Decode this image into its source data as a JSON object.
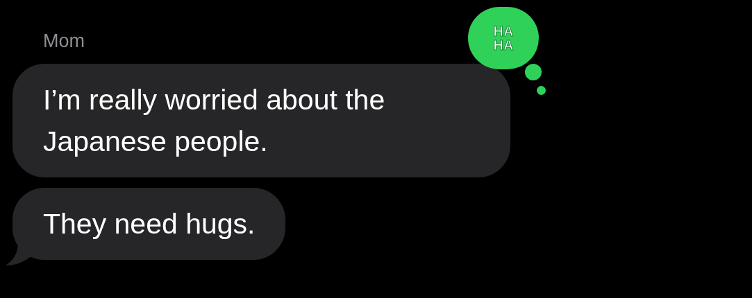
{
  "sender": "Mom",
  "messages": [
    {
      "text": "I’m really worried about the Japanese people.",
      "tail": false
    },
    {
      "text": "They need hugs.",
      "tail": true
    }
  ],
  "reaction": {
    "lines": [
      "HA",
      "HA"
    ]
  }
}
